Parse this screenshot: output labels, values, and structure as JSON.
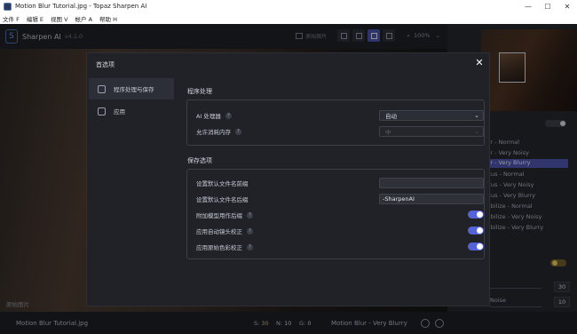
{
  "window": {
    "title": "Motion Blur Tutorial.jpg - Topaz Sharpen AI",
    "min": "—",
    "max": "☐",
    "close": "✕"
  },
  "menu": [
    "文件 F",
    "编辑 E",
    "视图 V",
    "帐户 A",
    "帮助 H"
  ],
  "toolbar": {
    "app_name": "Sharpen AI",
    "version": "v4.1.0",
    "compare_label": "原始图片",
    "zoom": "100%"
  },
  "canvas": {
    "label": "原始图片"
  },
  "bottombar": {
    "filename": "Motion Blur Tutorial.jpg",
    "s_label": "S:",
    "s_value": "30",
    "n_label": "N:",
    "n_value": "10",
    "g_label": "G:",
    "g_value": "0",
    "model": "Motion Blur - Very Blurry"
  },
  "right_panel": {
    "models": [
      {
        "label": "Blur - Normal",
        "active": false
      },
      {
        "label": "Blur - Very Noisy",
        "active": false
      },
      {
        "label": "Blur - Very Blurry",
        "active": true
      },
      {
        "label": "Focus - Normal",
        "active": false
      },
      {
        "label": "Focus - Very Noisy",
        "active": false
      },
      {
        "label": "Focus - Very Blurry",
        "active": false
      },
      {
        "label": "Stabilize - Normal",
        "active": false
      },
      {
        "label": "Stabilize - Very Noisy",
        "active": false
      },
      {
        "label": "Stabilize - Very Blurry",
        "active": false
      }
    ],
    "noise_label": "Noise",
    "value_1": "30",
    "value_2": "10"
  },
  "dialog": {
    "title": "首选项",
    "close": "✕",
    "nav": [
      {
        "label": "程序处理与保存",
        "active": true
      },
      {
        "label": "应用",
        "active": false
      }
    ],
    "processing": {
      "title": "程序处理",
      "ai_processor_label": "AI 处理器",
      "ai_processor_value": "自动",
      "memory_label": "允许消耗内存",
      "memory_value": "中"
    },
    "save": {
      "title": "保存选项",
      "prefix_label": "设置默认文件名前缀",
      "prefix_value": "",
      "suffix_label": "设置默认文件名后缀",
      "suffix_value": "-SharpenAI",
      "append_model_label": "附加模型用作后缀",
      "lens_correction_label": "应用自动镜头校正",
      "color_correction_label": "应用原始色彩校正"
    },
    "help_glyph": "?",
    "chevron": "⌄"
  }
}
